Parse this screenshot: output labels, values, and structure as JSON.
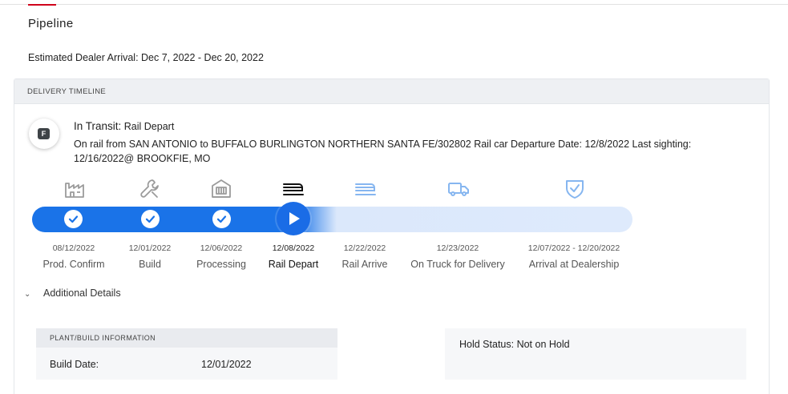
{
  "page": {
    "title": "Pipeline",
    "eta": "Estimated Dealer Arrival: Dec 7, 2022 - Dec 20, 2022"
  },
  "timeline": {
    "header": "DELIVERY TIMELINE",
    "badge": "F",
    "status_label": "In Transit:",
    "status_value": "Rail Depart",
    "description": "On rail from SAN ANTONIO to BUFFALO BURLINGTON NORTHERN SANTA FE/302802 Rail car Departure Date: 12/8/2022 Last sighting: 12/16/2022@ BROOKFIE, MO",
    "colors": {
      "active": "#1a73e8",
      "pending_track": "#deeafc",
      "done_icon": "#9b9b9b",
      "future_icon": "#86b6f0"
    },
    "steps": [
      {
        "date": "08/12/2022",
        "label": "Prod. Confirm",
        "state": "done",
        "icon": "factory-icon"
      },
      {
        "date": "12/01/2022",
        "label": "Build",
        "state": "done",
        "icon": "wrench-icon"
      },
      {
        "date": "12/06/2022",
        "label": "Processing",
        "state": "done",
        "icon": "processing-icon"
      },
      {
        "date": "12/08/2022",
        "label": "Rail Depart",
        "state": "current",
        "icon": "train-icon"
      },
      {
        "date": "12/22/2022",
        "label": "Rail Arrive",
        "state": "pending",
        "icon": "rail-arrive-icon"
      },
      {
        "date": "12/23/2022",
        "label": "On Truck for Delivery",
        "state": "pending",
        "icon": "truck-icon"
      },
      {
        "date": "12/07/2022 - 12/20/2022",
        "label": "Arrival at Dealership",
        "state": "pending",
        "icon": "shield-check-icon"
      }
    ]
  },
  "details": {
    "toggle_label": "Additional Details",
    "plant": {
      "header": "PLANT/BUILD INFORMATION",
      "build_date_label": "Build Date:",
      "build_date_value": "12/01/2022"
    },
    "hold": {
      "text": "Hold Status: Not on Hold"
    }
  }
}
